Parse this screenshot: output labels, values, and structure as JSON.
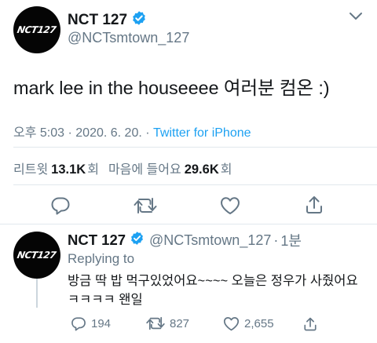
{
  "main_tweet": {
    "display_name": "NCT 127",
    "handle": "@NCTsmtown_127",
    "avatar_logo": "NCT127",
    "text": "mark lee in the houseeee 여러분 컴온 :)",
    "time": "오후 5:03",
    "date": "2020. 6. 20.",
    "separator": "·",
    "source": "Twitter for iPhone",
    "retweets_label": "리트윗",
    "retweets_count": "13.1K",
    "retweets_unit": "회",
    "likes_label": "마음에 들어요",
    "likes_count": "29.6K",
    "likes_unit": "회"
  },
  "reply_tweet": {
    "display_name": "NCT 127",
    "handle": "@NCTsmtown_127",
    "separator": "·",
    "time_ago": "1분",
    "avatar_logo": "NCT127",
    "replying_label": "Replying to",
    "replying_mention": "",
    "text_line1": "방금 딱 밥 먹구있었어요~~~~ 오늘은 정우가 사줬어요",
    "text_line2": "ㅋㅋㅋㅋ 왠일",
    "reply_count": "194",
    "retweet_count": "827",
    "like_count": "2,655"
  },
  "icons": {
    "verified": "verified-badge-icon",
    "chevron": "chevron-down-icon",
    "reply": "reply-icon",
    "retweet": "retweet-icon",
    "like": "heart-icon",
    "share": "share-icon"
  },
  "colors": {
    "accent": "#1da1f2",
    "text": "#14171a",
    "secondary": "#657786",
    "divider": "#e1e8ed"
  }
}
